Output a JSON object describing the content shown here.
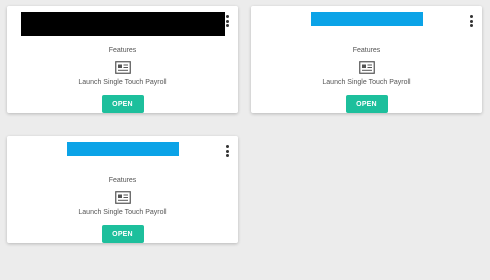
{
  "cards": [
    {
      "logo": "black-bar",
      "features_label": "Features",
      "icon": "payroll-document-icon",
      "description": "Launch Single Touch Payroll",
      "button_label": "OPEN"
    },
    {
      "logo": "blue-bar",
      "features_label": "Features",
      "icon": "payroll-document-icon",
      "description": "Launch Single Touch Payroll",
      "button_label": "OPEN"
    },
    {
      "logo": "blue-bar",
      "features_label": "Features",
      "icon": "payroll-document-icon",
      "description": "Launch Single Touch Payroll",
      "button_label": "OPEN"
    }
  ],
  "colors": {
    "background": "#ececec",
    "card": "#ffffff",
    "logo_black": "#000000",
    "logo_blue": "#0ba3e7",
    "button": "#1dbf9c",
    "text": "#555555"
  }
}
